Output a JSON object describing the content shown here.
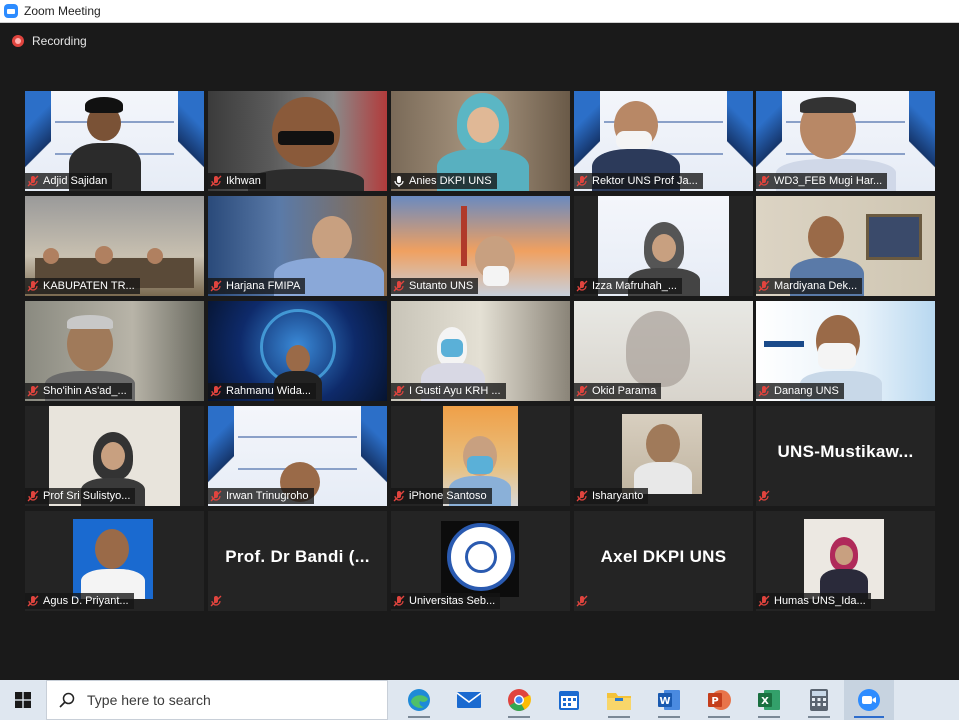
{
  "window": {
    "title": "Zoom Meeting"
  },
  "recording": {
    "label": "Recording"
  },
  "participants": [
    "Adjid Sajidan",
    "Ikhwan",
    "Anies DKPI UNS",
    "Rektor UNS Prof Ja...",
    "WD3_FEB Mugi Har...",
    "KABUPATEN TR...",
    "Harjana FMIPA",
    "Sutanto UNS",
    "Izza Mafruhah_...",
    "Mardiyana Dek...",
    "Sho'ihin As'ad_...",
    "Rahmanu Wida...",
    "I Gusti Ayu KRH ...",
    "Okid Parama",
    "Danang UNS",
    "Prof Sri Sulistyo...",
    "Irwan Trinugroho",
    "iPhone Santoso",
    "Isharyanto",
    "",
    "Agus D. Priyant...",
    "",
    "Universitas Seb...",
    "",
    "Humas UNS_Ida..."
  ],
  "big_names": {
    "t19": "UNS-Mustikaw...",
    "t21": "Prof. Dr Bandi (...",
    "t23": "Axel DKPI UNS"
  },
  "taskbar": {
    "search_placeholder": "Type here to search",
    "apps": [
      "edge-icon",
      "mail-icon",
      "chrome-icon",
      "calendar-icon",
      "file-explorer-icon",
      "word-icon",
      "powerpoint-icon",
      "excel-icon",
      "calculator-icon",
      "zoom-icon"
    ]
  },
  "colors": {
    "active_speaker": "#e4e36a",
    "mute": "#e0443e",
    "zoom": "#2d8cff"
  }
}
